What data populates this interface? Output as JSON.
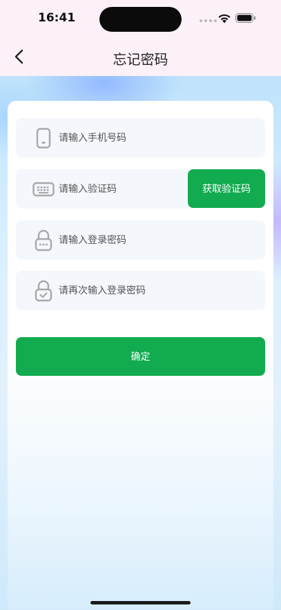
{
  "status_bar": {
    "time": "16:41"
  },
  "nav": {
    "title": "忘记密码",
    "back_icon": "chevron-left-icon"
  },
  "form": {
    "phone": {
      "placeholder": "请输入手机号码",
      "value": "",
      "icon": "phone-icon"
    },
    "code": {
      "placeholder": "请输入验证码",
      "value": "",
      "icon": "keyboard-icon"
    },
    "get_code_label": "获取验证码",
    "password": {
      "placeholder": "请输入登录密码",
      "value": "",
      "icon": "lock-icon"
    },
    "confirm_password": {
      "placeholder": "请再次输入登录密码",
      "value": "",
      "icon": "lock-check-icon"
    },
    "confirm_label": "确定"
  },
  "colors": {
    "accent": "#12ab4f",
    "field_bg": "#f4f7fc",
    "top_bg": "#fdf1f9"
  }
}
